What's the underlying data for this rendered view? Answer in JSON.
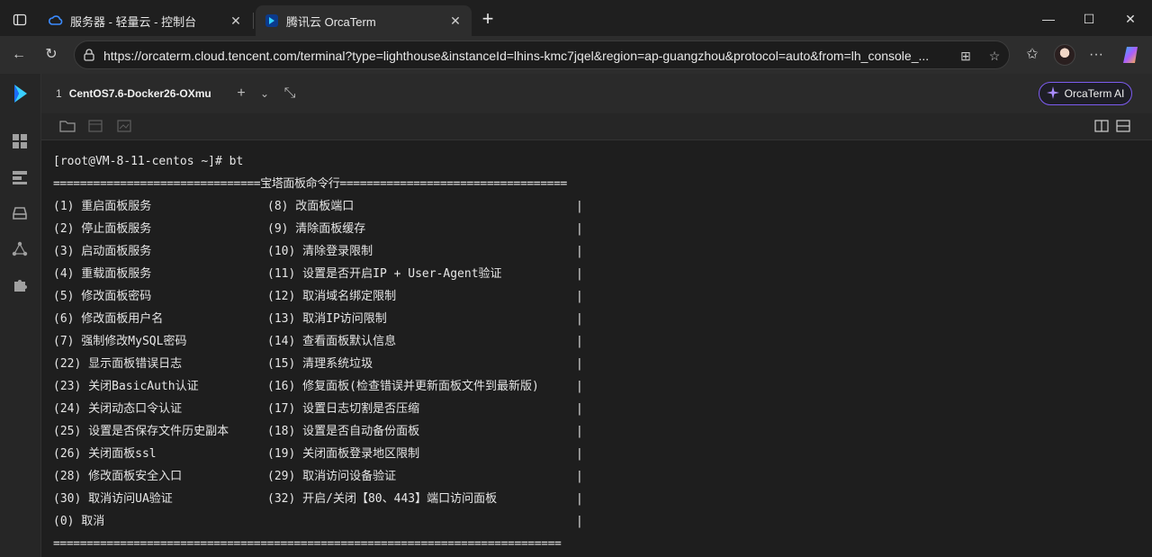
{
  "browser": {
    "tabs": [
      {
        "title": "服务器 - 轻量云 - 控制台",
        "active": false,
        "icon": "cloud-icon"
      },
      {
        "title": "腾讯云 OrcaTerm",
        "active": true,
        "icon": "orcaterm-icon"
      }
    ],
    "url": "https://orcaterm.cloud.tencent.com/terminal?type=lighthouse&instanceId=lhins-kmc7jqel&region=ap-guangzhou&protocol=auto&from=lh_console_..."
  },
  "app": {
    "session_tab": {
      "index": "1",
      "label": "CentOS7.6-Docker26-OXmu"
    },
    "ai_button": "OrcaTerm AI",
    "accent": "#7d5cf0"
  },
  "terminal": {
    "prompt": "[root@VM-8-11-centos ~]# bt",
    "header_rule": "===============================宝塔面板命令行==================================",
    "footer_rule": "============================================================================",
    "rows": [
      {
        "left": "(1) 重启面板服务",
        "right": "(8) 改面板端口"
      },
      {
        "left": "(2) 停止面板服务",
        "right": "(9) 清除面板缓存"
      },
      {
        "left": "(3) 启动面板服务",
        "right": "(10) 清除登录限制"
      },
      {
        "left": "(4) 重载面板服务",
        "right": "(11) 设置是否开启IP + User-Agent验证"
      },
      {
        "left": "(5) 修改面板密码",
        "right": "(12) 取消域名绑定限制"
      },
      {
        "left": "(6) 修改面板用户名",
        "right": "(13) 取消IP访问限制"
      },
      {
        "left": "(7) 强制修改MySQL密码",
        "right": "(14) 查看面板默认信息"
      },
      {
        "left": "(22) 显示面板错误日志",
        "right": "(15) 清理系统垃圾"
      },
      {
        "left": "(23) 关闭BasicAuth认证",
        "right": "(16) 修复面板(检查错误并更新面板文件到最新版)"
      },
      {
        "left": "(24) 关闭动态口令认证",
        "right": "(17) 设置日志切割是否压缩"
      },
      {
        "left": "(25) 设置是否保存文件历史副本",
        "right": "(18) 设置是否自动备份面板"
      },
      {
        "left": "(26) 关闭面板ssl",
        "right": "(19) 关闭面板登录地区限制"
      },
      {
        "left": "(28) 修改面板安全入口",
        "right": "(29) 取消访问设备验证"
      },
      {
        "left": "(30) 取消访问UA验证",
        "right": "(32) 开启/关闭【80、443】端口访问面板"
      },
      {
        "left": "(0) 取消",
        "right": ""
      }
    ],
    "bar_char": "|"
  }
}
